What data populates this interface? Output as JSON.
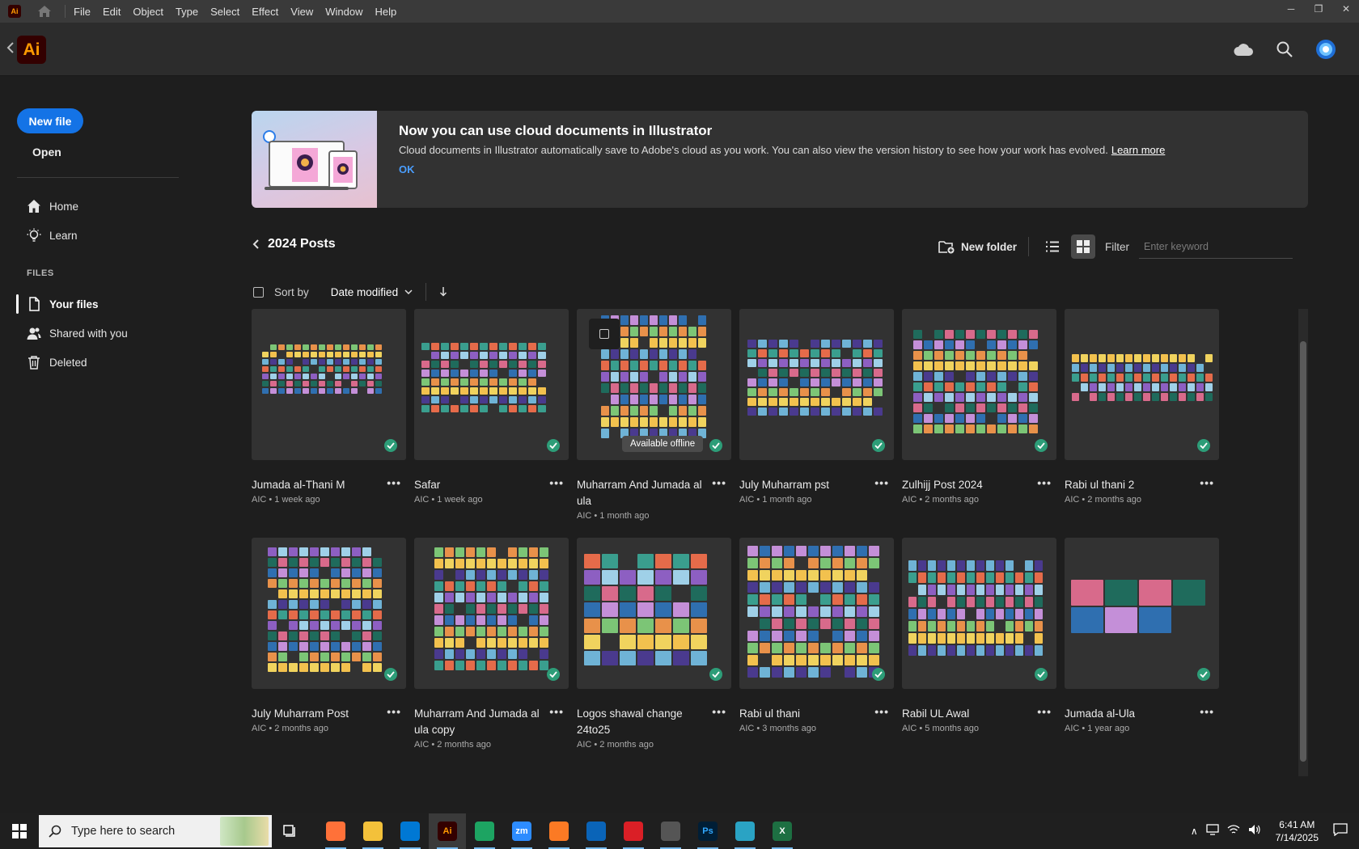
{
  "menubar": {
    "app_badge": "Ai",
    "items": [
      "File",
      "Edit",
      "Object",
      "Type",
      "Select",
      "Effect",
      "View",
      "Window",
      "Help"
    ]
  },
  "header": {
    "logo": "Ai"
  },
  "sidebar": {
    "new_file": "New file",
    "open": "Open",
    "nav": [
      {
        "label": "Home",
        "icon": "home-icon"
      },
      {
        "label": "Learn",
        "icon": "lightbulb-icon"
      }
    ],
    "files_heading": "FILES",
    "files": [
      {
        "label": "Your files",
        "icon": "document-icon"
      },
      {
        "label": "Shared with you",
        "icon": "people-icon"
      },
      {
        "label": "Deleted",
        "icon": "trash-icon"
      }
    ]
  },
  "banner": {
    "title": "Now you can use cloud documents in Illustrator",
    "description": "Cloud documents in Illustrator automatically save to Adobe's cloud as you work. You can also view the version history to see how your work has evolved.",
    "learn_more": "Learn more",
    "ok": "OK"
  },
  "breadcrumb": {
    "title": "2024 Posts"
  },
  "toolbar": {
    "new_folder": "New folder",
    "filter_label": "Filter",
    "filter_placeholder": "Enter keyword"
  },
  "sort": {
    "label": "Sort by",
    "value": "Date modified"
  },
  "tooltip": "Available offline",
  "files": [
    {
      "name": "Jumada al-Thani M",
      "meta": "AIC • 1 week ago"
    },
    {
      "name": "Safar",
      "meta": "AIC • 1 week ago"
    },
    {
      "name": "Muharram And Jumada al ula",
      "meta": "AIC • 1 month ago"
    },
    {
      "name": "July Muharram pst",
      "meta": "AIC • 1 month ago"
    },
    {
      "name": "Zulhijj Post 2024",
      "meta": "AIC • 2 months ago"
    },
    {
      "name": "Rabi ul thani 2",
      "meta": "AIC • 2 months ago"
    },
    {
      "name": "July Muharram Post",
      "meta": "AIC • 2 months ago"
    },
    {
      "name": "Muharram And Jumada al ula copy",
      "meta": "AIC • 2 months ago"
    },
    {
      "name": "Logos shawal change 24to25",
      "meta": "AIC • 2 months ago"
    },
    {
      "name": "Rabi ul thani",
      "meta": "AIC • 3 months ago"
    },
    {
      "name": "Rabil UL Awal",
      "meta": "AIC • 5 months ago"
    },
    {
      "name": "Jumada al-Ula",
      "meta": "AIC • 1 year ago"
    }
  ],
  "taskbar": {
    "search_placeholder": "Type here to search",
    "apps": [
      {
        "icon": "firefox-icon",
        "label": "",
        "color": "#ff7139"
      },
      {
        "icon": "file-explorer-icon",
        "label": "",
        "color": "#f3c13a"
      },
      {
        "icon": "vscode-icon",
        "label": "",
        "color": "#0078d4"
      },
      {
        "icon": "illustrator-icon",
        "label": "Ai",
        "color": "#330000"
      },
      {
        "icon": "chrome-icon",
        "label": "",
        "color": "#1da462"
      },
      {
        "icon": "zoom-icon",
        "label": "zm",
        "color": "#2d8cff"
      },
      {
        "icon": "xampp-icon",
        "label": "",
        "color": "#fb7a24"
      },
      {
        "icon": "outlook-icon",
        "label": "",
        "color": "#0a64b8"
      },
      {
        "icon": "creative-cloud-icon",
        "label": "",
        "color": "#da1f26"
      },
      {
        "icon": "pen-tool-icon",
        "label": "",
        "color": "#555555"
      },
      {
        "icon": "photoshop-icon",
        "label": "Ps",
        "color": "#001e36"
      },
      {
        "icon": "diamond-app-icon",
        "label": "",
        "color": "#2aa3c4"
      },
      {
        "icon": "excel-icon",
        "label": "X",
        "color": "#1d6f42"
      }
    ],
    "time": "6:41 AM",
    "date": "7/14/2025"
  }
}
